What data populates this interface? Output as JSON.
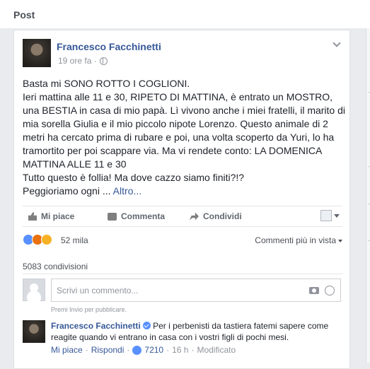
{
  "header": {
    "title": "Post"
  },
  "post": {
    "author": "Francesco Facchinetti",
    "time": "19 ore fa ·",
    "text": "Basta mi SONO ROTTO I COGLIONI.\nIeri mattina alle 11 e 30, RIPETO DI MATTINA, è entrato un MOSTRO, una BESTIA in casa di mio papà. Lì vivono anche i miei fratelli, il marito di mia sorella Giulia e il mio piccolo nipote Lorenzo. Questo animale di 2 metri ha cercato prima di rubare e poi, una volta scoperto da Yuri, lo ha tramortito per poi scappare via. Ma vi rendete conto: LA DOMENICA MATTINA ALLE 11 e 30\nTutto questo è follia! Ma dove cazzo siamo finiti?!?\nPeggioriamo ogni ...",
    "more": "Altro..."
  },
  "actions": {
    "like": "Mi piace",
    "comment": "Commenta",
    "share": "Condividi"
  },
  "reactions": {
    "count": "52 mila",
    "sort": "Commenti più in vista"
  },
  "shares": "5083 condivisioni",
  "composer": {
    "placeholder": "Scrivi un commento...",
    "hint": "Premi Invio per pubblicare."
  },
  "reply": {
    "author": "Francesco Facchinetti",
    "text": "Per i perbenisti da tastiera fatemi sapere come reagite quando vi entrano in casa con i vostri figli di pochi mesi.",
    "like": "Mi piace",
    "reply": "Rispondi",
    "like_count": "7210",
    "time": "16 h",
    "edited": "Modificato",
    "sep": "·"
  },
  "colors": {
    "link": "#365899",
    "muted": "#90949c",
    "like_blue": "#5890ff"
  }
}
